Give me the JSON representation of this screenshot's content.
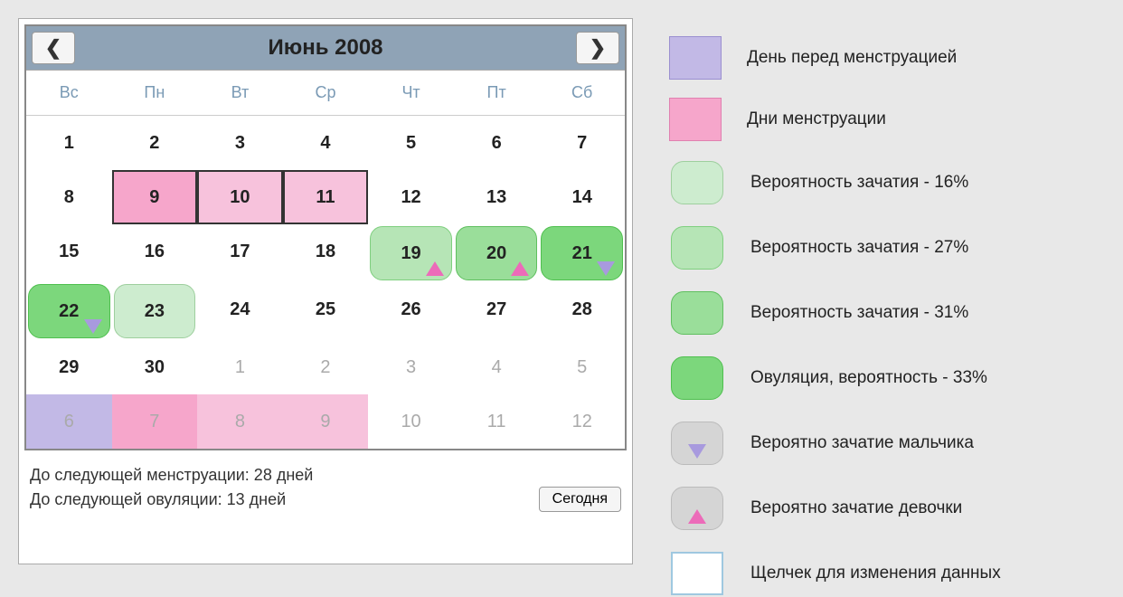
{
  "calendar": {
    "month_title": "Июнь 2008",
    "weekdays": [
      "Вс",
      "Пн",
      "Вт",
      "Ср",
      "Чт",
      "Пт",
      "Сб"
    ],
    "cells": [
      {
        "d": "1"
      },
      {
        "d": "2"
      },
      {
        "d": "3"
      },
      {
        "d": "4"
      },
      {
        "d": "5"
      },
      {
        "d": "6"
      },
      {
        "d": "7"
      },
      {
        "d": "8"
      },
      {
        "d": "9",
        "cls": "bg-pink menstr-border"
      },
      {
        "d": "10",
        "cls": "bg-lightpink menstr-border"
      },
      {
        "d": "11",
        "cls": "bg-lightpink menstr-border"
      },
      {
        "d": "12"
      },
      {
        "d": "13"
      },
      {
        "d": "14"
      },
      {
        "d": "15"
      },
      {
        "d": "16"
      },
      {
        "d": "17"
      },
      {
        "d": "18"
      },
      {
        "d": "19",
        "cls": "green27",
        "tri": "pink"
      },
      {
        "d": "20",
        "cls": "green31",
        "tri": "pink"
      },
      {
        "d": "21",
        "cls": "green33",
        "tri": "lilac"
      },
      {
        "d": "22",
        "cls": "green33",
        "tri": "lilac"
      },
      {
        "d": "23",
        "cls": "green16"
      },
      {
        "d": "24"
      },
      {
        "d": "25"
      },
      {
        "d": "26"
      },
      {
        "d": "27"
      },
      {
        "d": "28"
      },
      {
        "d": "29"
      },
      {
        "d": "30"
      },
      {
        "d": "1",
        "o": true
      },
      {
        "d": "2",
        "o": true
      },
      {
        "d": "3",
        "o": true
      },
      {
        "d": "4",
        "o": true
      },
      {
        "d": "5",
        "o": true
      },
      {
        "d": "6",
        "o": true,
        "cls": "bg-lilac"
      },
      {
        "d": "7",
        "o": true,
        "cls": "bg-pink"
      },
      {
        "d": "8",
        "o": true,
        "cls": "bg-lightpink"
      },
      {
        "d": "9",
        "o": true,
        "cls": "bg-lightpink"
      },
      {
        "d": "10",
        "o": true
      },
      {
        "d": "11",
        "o": true
      },
      {
        "d": "12",
        "o": true
      }
    ],
    "footer": {
      "next_menstr": "До следующей менструации: 28 дней",
      "next_ovul": "До следующей овуляции: 13 дней",
      "today_btn": "Сегодня"
    }
  },
  "legend": [
    {
      "sw": "bg-lilac",
      "label": "День перед менструацией"
    },
    {
      "sw": "bg-pink",
      "label": "Дни менструации"
    },
    {
      "sw": "green16",
      "label": "Вероятность зачатия - 16%"
    },
    {
      "sw": "green27",
      "label": "Вероятность зачатия - 27%"
    },
    {
      "sw": "green31",
      "label": "Вероятность зачатия - 31%"
    },
    {
      "sw": "green33",
      "label": "Овуляция, вероятность - 33%"
    },
    {
      "sw": "bg-grey",
      "tri": "lilac",
      "label": "Вероятно зачатие мальчика"
    },
    {
      "sw": "bg-grey",
      "tri": "pink",
      "label": "Вероятно зачатие девочки"
    },
    {
      "sw": "bg-white-outline",
      "label": "Щелчек для изменения данных"
    }
  ]
}
